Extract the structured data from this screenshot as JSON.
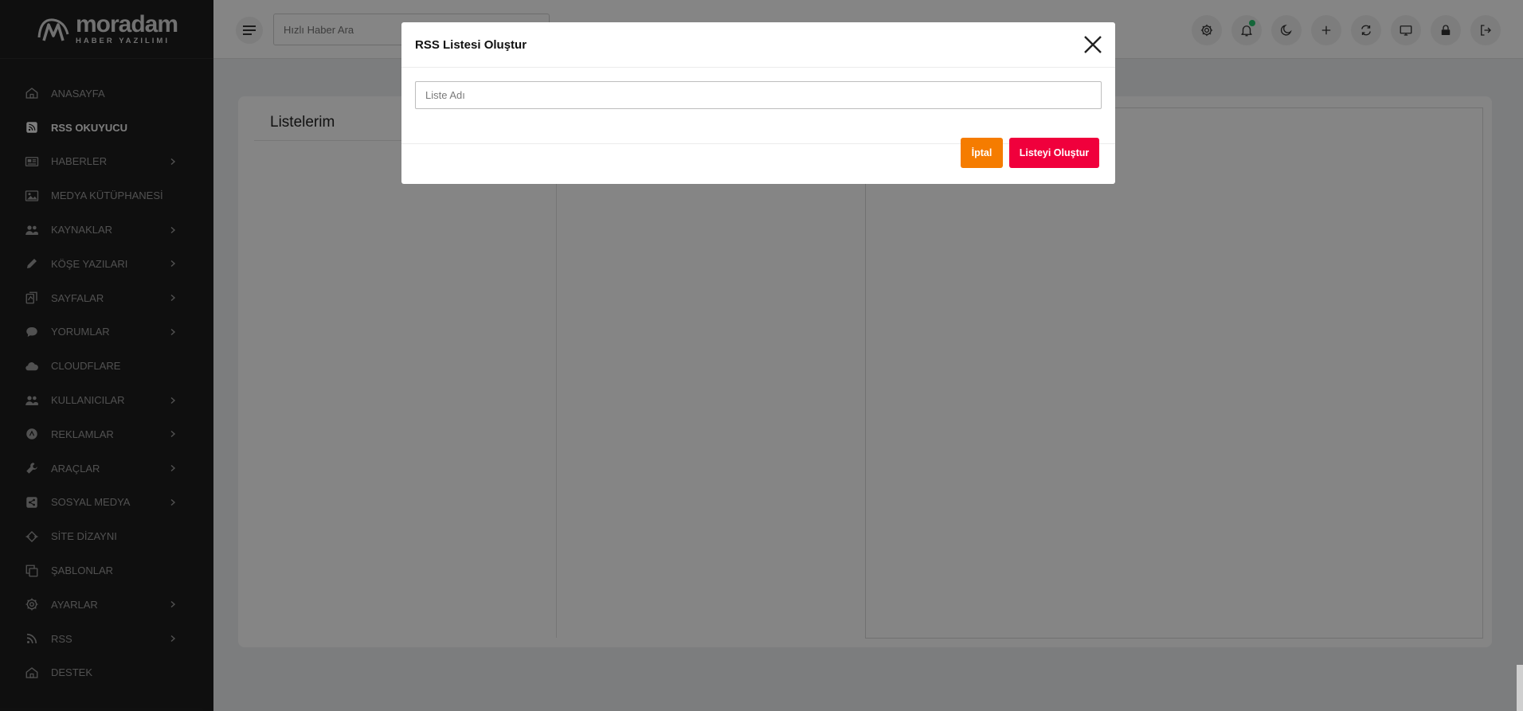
{
  "brand": {
    "name": "moradam",
    "tagline": "HABER YAZILIMI"
  },
  "sidebar": {
    "items": [
      {
        "label": "ANASAYFA",
        "icon": "home-icon",
        "submenu": false,
        "active": false
      },
      {
        "label": "RSS OKUYUCU",
        "icon": "rss-square-icon",
        "submenu": false,
        "active": true
      },
      {
        "label": "HABERLER",
        "icon": "newspaper-icon",
        "submenu": true,
        "active": false
      },
      {
        "label": "MEDYA KÜTÜPHANESİ",
        "icon": "image-icon",
        "submenu": false,
        "active": false
      },
      {
        "label": "KAYNAKLAR",
        "icon": "users-icon",
        "submenu": true,
        "active": false
      },
      {
        "label": "KÖŞE YAZILARI",
        "icon": "pencil-icon",
        "submenu": true,
        "active": false
      },
      {
        "label": "SAYFALAR",
        "icon": "pages-icon",
        "submenu": true,
        "active": false
      },
      {
        "label": "YORUMLAR",
        "icon": "comment-icon",
        "submenu": true,
        "active": false
      },
      {
        "label": "CLOUDFLARE",
        "icon": "cloud-icon",
        "submenu": false,
        "active": false
      },
      {
        "label": "KULLANICILAR",
        "icon": "users-icon",
        "submenu": true,
        "active": false
      },
      {
        "label": "REKLAMLAR",
        "icon": "ad-icon",
        "submenu": true,
        "active": false
      },
      {
        "label": "ARAÇLAR",
        "icon": "wrench-icon",
        "submenu": true,
        "active": false
      },
      {
        "label": "SOSYAL MEDYA",
        "icon": "share-icon",
        "submenu": true,
        "active": false
      },
      {
        "label": "SİTE DİZAYNI",
        "icon": "design-icon",
        "submenu": false,
        "active": false
      },
      {
        "label": "ŞABLONLAR",
        "icon": "copy-icon",
        "submenu": false,
        "active": false
      },
      {
        "label": "AYARLAR",
        "icon": "gear-icon",
        "submenu": true,
        "active": false
      },
      {
        "label": "RSS",
        "icon": "rss-icon",
        "submenu": true,
        "active": false
      },
      {
        "label": "DESTEK",
        "icon": "home-icon",
        "submenu": false,
        "active": false
      }
    ]
  },
  "topbar": {
    "search_placeholder": "Hızlı Haber Ara",
    "icons": [
      "settings-icon",
      "bell-icon",
      "moon-icon",
      "plus-icon",
      "refresh-icon",
      "monitor-icon",
      "lock-icon",
      "logout-icon"
    ],
    "notification_dot_color": "#28c36d"
  },
  "main": {
    "title": "Listelerim"
  },
  "modal": {
    "title": "RSS Listesi Oluştur",
    "input_placeholder": "Liste Adı",
    "input_value": "",
    "cancel_label": "İptal",
    "create_label": "Listeyi Oluştur",
    "cancel_color": "#f57c00",
    "create_color": "#f0003c"
  }
}
